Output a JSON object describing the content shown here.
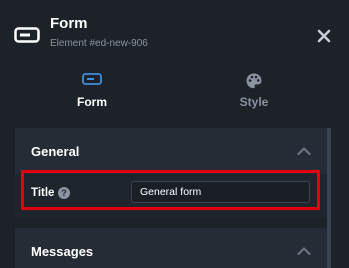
{
  "header": {
    "title": "Form",
    "subtitle": "Element #ed-new-906",
    "icon": "form-element-icon",
    "close_icon": "close-icon"
  },
  "tabs": [
    {
      "label": "Form",
      "icon": "form-tab-icon",
      "active": true
    },
    {
      "label": "Style",
      "icon": "palette-icon",
      "active": false
    }
  ],
  "sections": {
    "general": {
      "title": "General",
      "expanded": true,
      "fields": [
        {
          "label": "Title",
          "value": "General form",
          "help_icon": "help-icon"
        }
      ]
    },
    "messages": {
      "title": "Messages",
      "expanded": true
    }
  },
  "colors": {
    "background": "#1d2229",
    "section_background": "#262c35",
    "accent_blue": "#3d8fe0",
    "highlight_red": "#e3000f",
    "muted_text": "#8a93a0"
  }
}
